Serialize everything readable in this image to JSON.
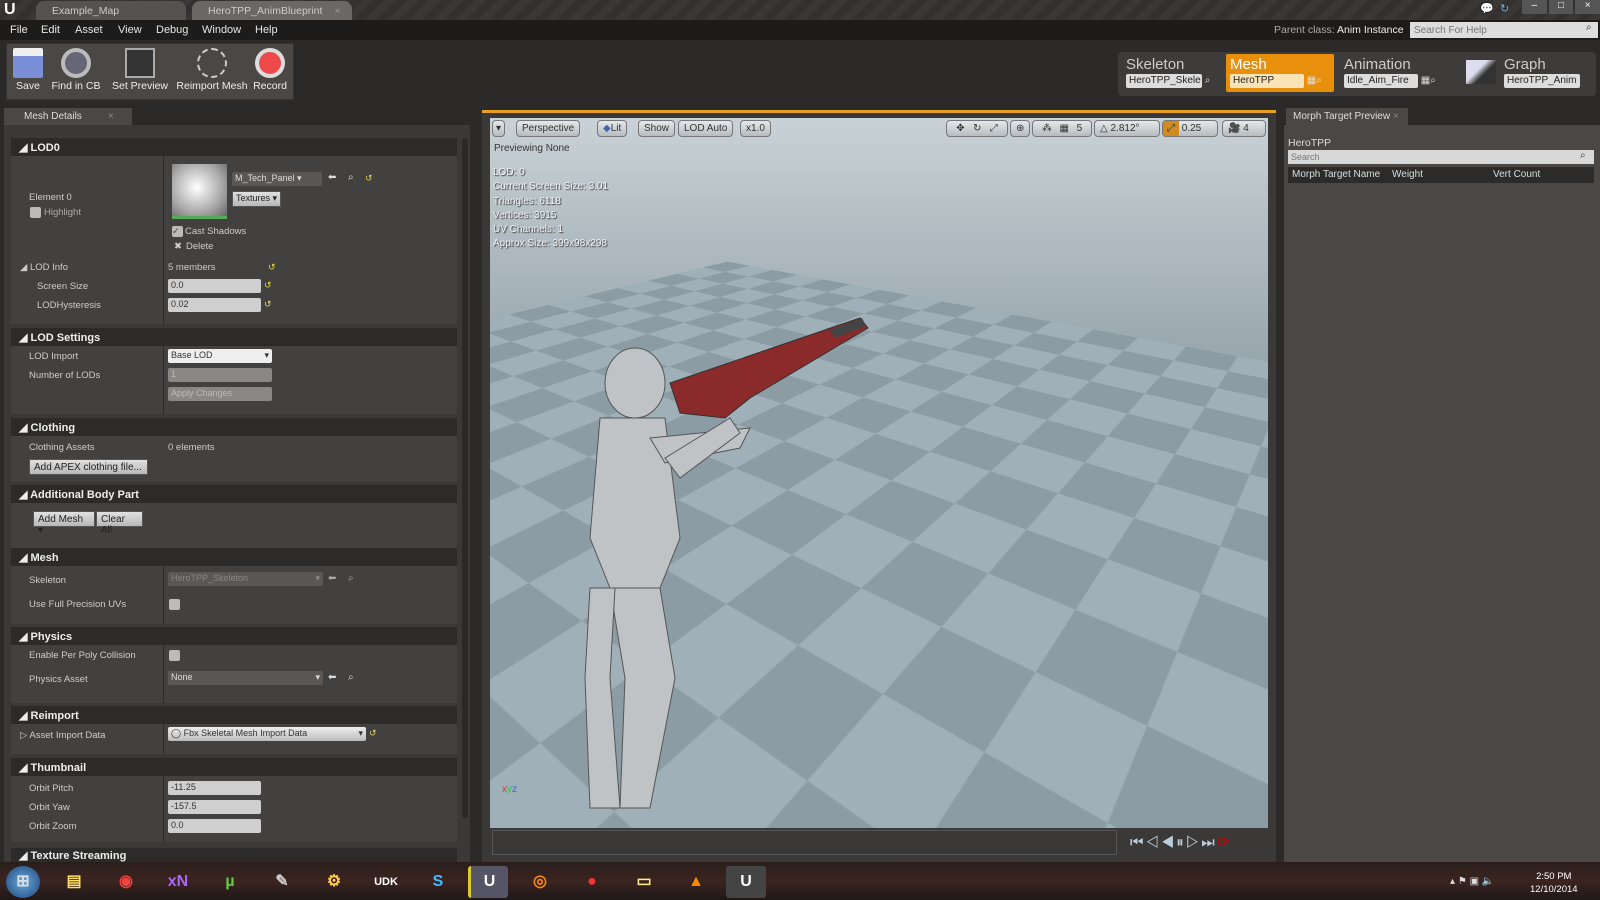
{
  "window": {
    "tabs": [
      "Example_Map",
      "HeroTPP_AnimBlueprint"
    ]
  },
  "menu": [
    "File",
    "Edit",
    "Asset",
    "View",
    "Debug",
    "Window",
    "Help"
  ],
  "parent_class": {
    "label": "Parent class:",
    "value": "Anim Instance"
  },
  "help_search": {
    "placeholder": "Search For Help"
  },
  "toolbar": [
    {
      "label": "Save",
      "icon": "save-icon"
    },
    {
      "label": "Find in CB",
      "icon": "find-icon"
    },
    {
      "label": "Set Preview",
      "icon": "set-preview-icon"
    },
    {
      "label": "Reimport Mesh",
      "icon": "reimport-icon"
    },
    {
      "label": "Record",
      "icon": "record-icon"
    }
  ],
  "modes": [
    {
      "title": "Skeleton",
      "field": "HeroTPP_Skele"
    },
    {
      "title": "Mesh",
      "field": "HeroTPP",
      "active": true
    },
    {
      "title": "Animation",
      "field": "Idle_Aim_Fire"
    },
    {
      "title": "Graph",
      "field": "HeroTPP_Anim"
    }
  ],
  "accent": "#e8900c",
  "details": {
    "tab": "Mesh Details",
    "lod0": {
      "title": "LOD0",
      "element": "Element 0",
      "highlight": "Highlight",
      "material": "M_Tech_Panel",
      "textures": "Textures",
      "cast_shadows": "Cast Shadows",
      "delete": "Delete",
      "lod_info": "LOD Info",
      "members": "5 members",
      "screen_size_label": "Screen Size",
      "screen_size": "0.0",
      "hyst_label": "LODHysteresis",
      "hyst": "0.02"
    },
    "lod_settings": {
      "title": "LOD Settings",
      "import_label": "LOD Import",
      "import_value": "Base LOD",
      "num_label": "Number of LODs",
      "num_value": "1",
      "apply": "Apply Changes"
    },
    "clothing": {
      "title": "Clothing",
      "assets_label": "Clothing Assets",
      "assets_value": "0 elements",
      "add": "Add APEX clothing file..."
    },
    "body": {
      "title": "Additional Body Part",
      "add_mesh": "Add Mesh",
      "clear": "Clear All"
    },
    "mesh": {
      "title": "Mesh",
      "skeleton_label": "Skeleton",
      "skeleton_value": "HeroTPP_Skeleton",
      "uv_label": "Use Full Precision UVs"
    },
    "physics": {
      "title": "Physics",
      "poly_label": "Enable Per Poly Collision",
      "asset_label": "Physics Asset",
      "asset_value": "None"
    },
    "reimport": {
      "title": "Reimport",
      "label": "Asset Import Data",
      "value": "Fbx Skeletal Mesh Import Data"
    },
    "thumbnail": {
      "title": "Thumbnail",
      "pitch_label": "Orbit Pitch",
      "pitch": "-11.25",
      "yaw_label": "Orbit Yaw",
      "yaw": "-157.5",
      "zoom_label": "Orbit Zoom",
      "zoom": "0.0"
    },
    "streaming": {
      "title": "Texture Streaming"
    }
  },
  "viewport": {
    "buttons": [
      "Perspective",
      "Lit",
      "Show",
      "LOD Auto",
      "x1.0"
    ],
    "grid_snap": "5",
    "rot_snap": "2.812°",
    "scale_snap": "0.25",
    "cam_speed": "4",
    "previewing": "Previewing None",
    "stats": [
      "LOD: 0",
      "Current Screen Size: 3.01",
      "Triangles: 6118",
      "Vertices: 3915",
      "UV Channels: 1",
      "Approx Size: 399x98x298"
    ]
  },
  "morph": {
    "tab": "Morph Target Preview",
    "mesh": "HeroTPP",
    "search_placeholder": "Search",
    "columns": [
      "Morph Target Name",
      "Weight",
      "Vert Count"
    ]
  },
  "taskbar": {
    "time": "2:50 PM",
    "date": "12/10/2014"
  }
}
